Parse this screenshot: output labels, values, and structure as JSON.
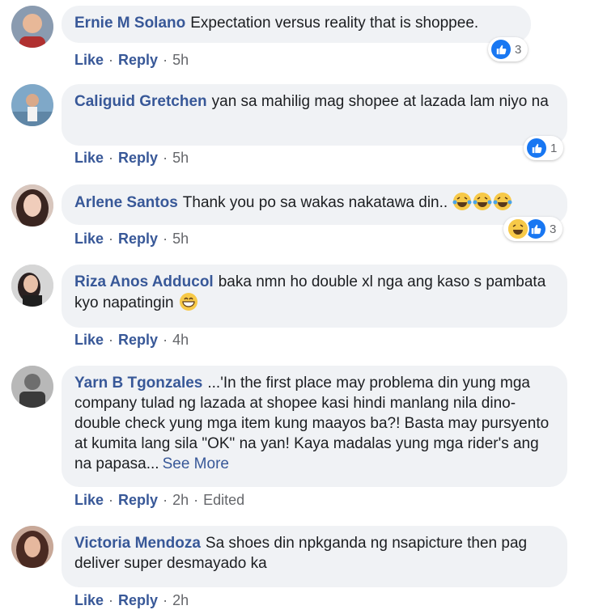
{
  "comments": [
    {
      "author": "Ernie M Solano",
      "text": "Expectation versus reality that is shoppee.",
      "like": "Like",
      "reply": "Reply",
      "time": "5h",
      "reactions": {
        "count": "3",
        "types": [
          "like"
        ]
      }
    },
    {
      "author": "Caliguid Gretchen",
      "text": "yan sa mahilig mag shopee at lazada lam niyo na",
      "like": "Like",
      "reply": "Reply",
      "time": "5h",
      "reactions": {
        "count": "1",
        "types": [
          "like"
        ]
      }
    },
    {
      "author": "Arlene Santos",
      "text": "Thank you po sa wakas nakatawa din..",
      "like": "Like",
      "reply": "Reply",
      "time": "5h",
      "emoji": [
        "laughing-tears",
        "laughing-tears",
        "laughing-tears"
      ],
      "reactions": {
        "count": "3",
        "types": [
          "haha",
          "like"
        ]
      }
    },
    {
      "author": "Riza Anos Adducol",
      "text": "baka nmn ho double xl nga ang kaso s pambata kyo napatingin",
      "like": "Like",
      "reply": "Reply",
      "time": "4h",
      "emoji": [
        "grinning"
      ]
    },
    {
      "author": "Yarn B Tgonzales",
      "text": "...'In the first place may problema din yung mga company tulad ng lazada at shopee kasi hindi manlang nila dino-double check yung mga item kung maayos ba?! Basta may pursyento at kumita lang sila \"OK\" na yan! Kaya madalas yung mga rider's ang na papasa...",
      "see_more": "See More",
      "like": "Like",
      "reply": "Reply",
      "time": "2h",
      "edited": "Edited"
    },
    {
      "author": "Victoria Mendoza",
      "text": "Sa shoes din npkganda ng nsapicture then pag deliver super desmayado ka",
      "like": "Like",
      "reply": "Reply",
      "time": "2h"
    }
  ],
  "colors": {
    "author": "#385898",
    "bubble": "#f0f2f5",
    "like_blue": "#1877f2",
    "meta": "#65676b"
  },
  "separator": "·"
}
